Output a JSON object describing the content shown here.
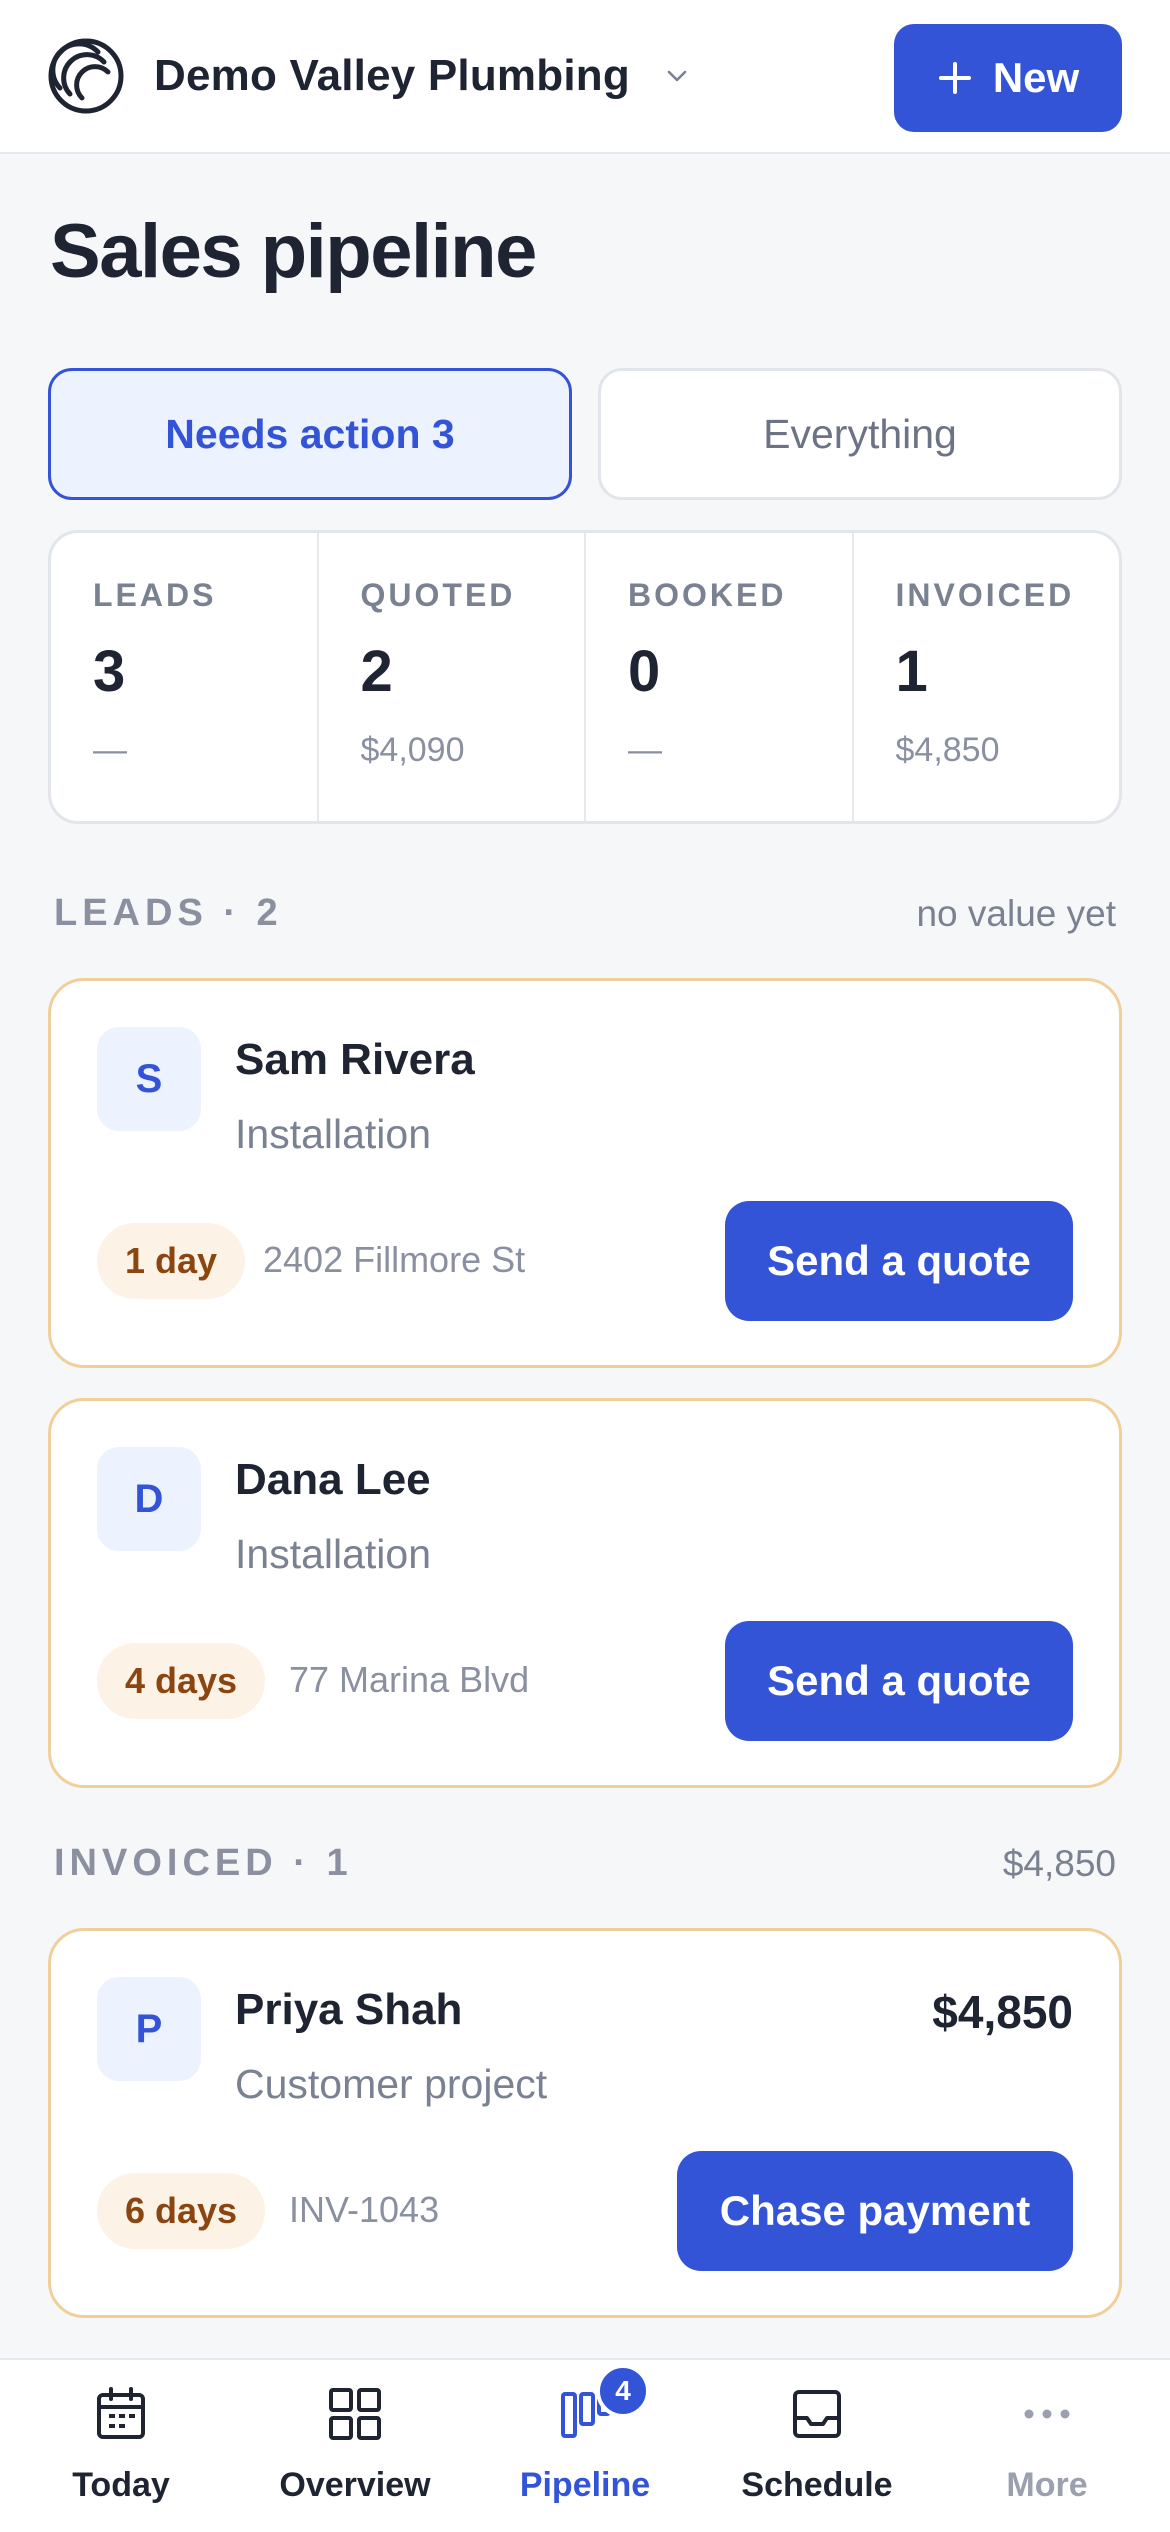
{
  "header": {
    "business_name": "Demo Valley Plumbing",
    "new_label": "New",
    "logo_icon": "concentric-arcs-logo",
    "accent_color": "#3354d6"
  },
  "page": {
    "title": "Sales pipeline"
  },
  "filters": {
    "active_label": "Needs action 3",
    "inactive_label": "Everything"
  },
  "stats": [
    {
      "label": "LEADS",
      "count": "3",
      "sub": "—"
    },
    {
      "label": "QUOTED",
      "count": "2",
      "sub": "$4,090"
    },
    {
      "label": "BOOKED",
      "count": "0",
      "sub": "—"
    },
    {
      "label": "INVOICED",
      "count": "1",
      "sub": "$4,850"
    }
  ],
  "sections": {
    "leads": {
      "title": "LEADS · 2",
      "meta": "no value yet"
    },
    "invoiced": {
      "title": "INVOICED · 1",
      "meta": "$4,850"
    }
  },
  "cards": [
    {
      "initial": "S",
      "name": "Sam Rivera",
      "type": "Installation",
      "age": "1 day",
      "detail": "2402 Fillmore St",
      "action": "Send a quote",
      "amount": ""
    },
    {
      "initial": "D",
      "name": "Dana Lee",
      "type": "Installation",
      "age": "4 days",
      "detail": "77 Marina Blvd",
      "action": "Send a quote",
      "amount": ""
    },
    {
      "initial": "P",
      "name": "Priya Shah",
      "type": "Customer project",
      "age": "6 days",
      "detail": "INV-1043",
      "action": "Chase payment",
      "amount": "$4,850"
    }
  ],
  "nav": [
    {
      "label": "Today",
      "icon": "calendar-icon"
    },
    {
      "label": "Overview",
      "icon": "grid-icon"
    },
    {
      "label": "Pipeline",
      "icon": "kanban-icon",
      "badge": "4"
    },
    {
      "label": "Schedule",
      "icon": "inbox-icon"
    },
    {
      "label": "More",
      "icon": "more-icon"
    }
  ]
}
